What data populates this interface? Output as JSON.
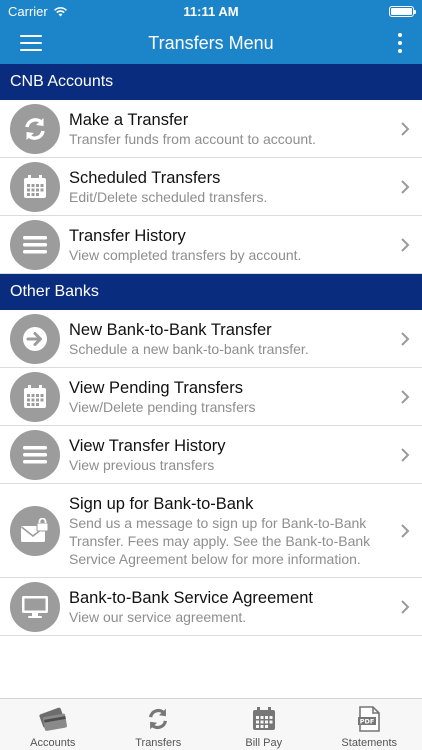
{
  "status_bar": {
    "carrier": "Carrier",
    "time": "11:11 AM"
  },
  "nav": {
    "title": "Transfers Menu"
  },
  "sections": [
    {
      "header": "CNB Accounts",
      "items": [
        {
          "title": "Make a Transfer",
          "subtitle": "Transfer funds from account to account.",
          "icon": "refresh-icon"
        },
        {
          "title": "Scheduled Transfers",
          "subtitle": "Edit/Delete scheduled transfers.",
          "icon": "calendar-icon"
        },
        {
          "title": "Transfer History",
          "subtitle": "View completed transfers by account.",
          "icon": "list-icon"
        }
      ]
    },
    {
      "header": "Other Banks",
      "items": [
        {
          "title": "New Bank-to-Bank Transfer",
          "subtitle": "Schedule a new bank-to-bank transfer.",
          "icon": "arrow-right-icon"
        },
        {
          "title": "View Pending Transfers",
          "subtitle": "View/Delete pending transfers",
          "icon": "calendar-icon"
        },
        {
          "title": "View Transfer History",
          "subtitle": "View previous transfers",
          "icon": "list-icon"
        },
        {
          "title": "Sign up for Bank-to-Bank",
          "subtitle": "Send us a message to sign up for Bank-to-Bank Transfer.  Fees may apply.  See the Bank-to-Bank Service Agreement below for more information.",
          "icon": "mail-lock-icon"
        },
        {
          "title": "Bank-to-Bank Service Agreement",
          "subtitle": "View our service agreement.",
          "icon": "monitor-icon"
        }
      ]
    }
  ],
  "tabs": [
    {
      "label": "Accounts",
      "icon": "cards-icon"
    },
    {
      "label": "Transfers",
      "icon": "refresh-icon"
    },
    {
      "label": "Bill Pay",
      "icon": "calendar-icon"
    },
    {
      "label": "Statements",
      "icon": "pdf-icon"
    }
  ],
  "colors": {
    "brand_blue": "#1c84c9",
    "section_navy": "#0a2c7e",
    "icon_gray": "#9c9c9c"
  }
}
